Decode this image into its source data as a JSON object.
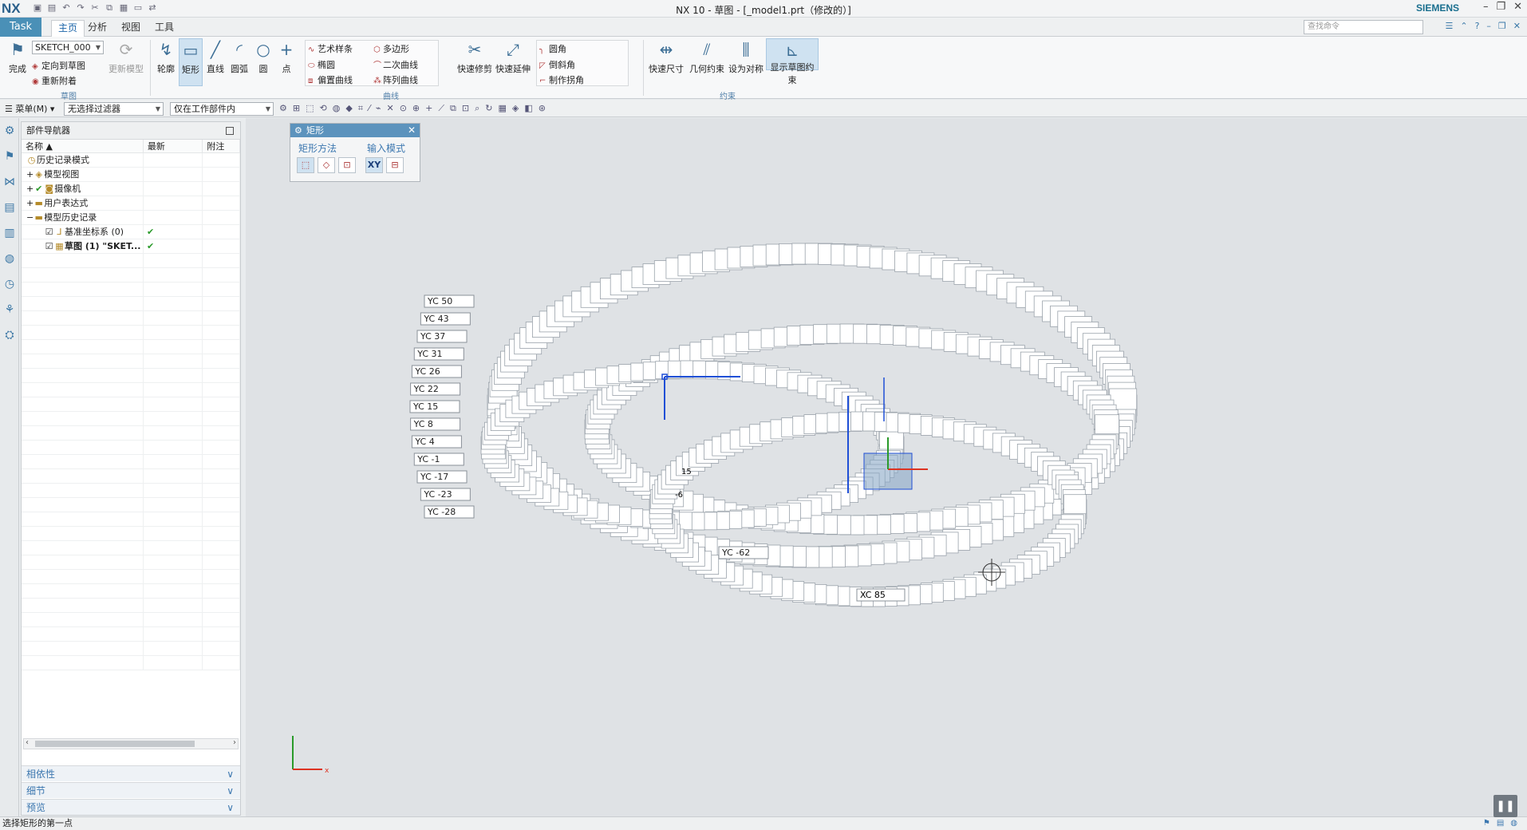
{
  "app": {
    "logo": "NX",
    "window_title": "NX 10 - 草图 - [_model1.prt（修改的）]",
    "brand": "SIEMENS"
  },
  "tabs": {
    "task": "Task",
    "items": [
      "主页",
      "分析",
      "视图",
      "工具"
    ],
    "search_placeholder": "查找命令"
  },
  "ribbon": {
    "finish": "完成",
    "sketch_name": "SKETCH_000",
    "orient": "定向到草图",
    "reattach": "重新附着",
    "update_model": "更新模型",
    "sketch_group": "草图",
    "curve_tools": [
      "轮廓",
      "矩形",
      "直线",
      "圆弧",
      "圆",
      "点"
    ],
    "curve_small": [
      "艺术样条",
      "多边形",
      "椭圆",
      "二次曲线",
      "偏置曲线",
      "阵列曲线"
    ],
    "trim": "快速修剪",
    "extend": "快速延伸",
    "corner_small": [
      "圆角",
      "倒斜角",
      "制作拐角"
    ],
    "curve_group": "曲线",
    "constraint_tools": [
      "快速尺寸",
      "几何约束",
      "设为对称",
      "显示草图约束"
    ],
    "constraint_group": "约束"
  },
  "filterbar": {
    "menu": "菜单(M)",
    "filter": "无选择过滤器",
    "scope": "仅在工作部件内"
  },
  "navigator": {
    "title": "部件导航器",
    "columns": [
      "名称",
      "最新",
      "附注"
    ],
    "rows": [
      {
        "label": "历史记录模式",
        "check": ""
      },
      {
        "label": "模型视图",
        "check": ""
      },
      {
        "label": "摄像机",
        "check": ""
      },
      {
        "label": "用户表达式",
        "check": ""
      },
      {
        "label": "模型历史记录",
        "check": ""
      },
      {
        "label": "基准坐标系 (0)",
        "check": "✔"
      },
      {
        "label": "草图 (1) \"SKET...",
        "check": "✔"
      }
    ],
    "panels": [
      "相依性",
      "细节",
      "预览"
    ]
  },
  "dialog": {
    "title": "矩形",
    "method_label": "矩形方法",
    "input_label": "输入模式",
    "xy": "XY"
  },
  "graphics": {
    "yc_labels": [
      "YC 50",
      "YC 43",
      "YC 37",
      "YC 31",
      "YC 26",
      "YC 22",
      "YC 15",
      "YC 8",
      "YC 4",
      "YC -1",
      "YC -17",
      "YC -23",
      "YC -28",
      "YC -62"
    ],
    "xc_label": "XC 85",
    "small_label": "-6",
    "small_label2": "15"
  },
  "status": {
    "prompt": "选择矩形的第一点"
  },
  "colors": {
    "accent": "#4a90b7",
    "sketch_blue": "#1f4fd6"
  }
}
